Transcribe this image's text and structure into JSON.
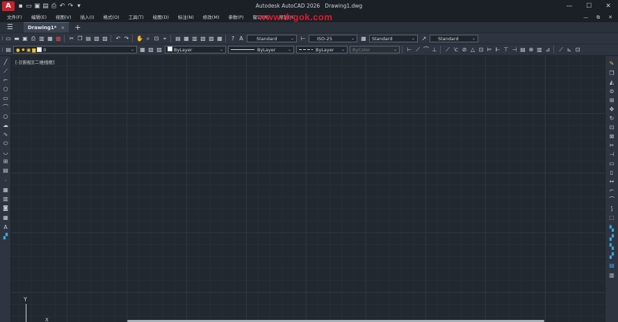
{
  "titlebar": {
    "app_name": "Autodesk AutoCAD 2026",
    "file_name": "Drawing1.dwg",
    "logo_letter": "A",
    "minimize": "—",
    "restore": "☐",
    "close": "✕"
  },
  "menubar": {
    "items": [
      "文件(F)",
      "编辑(E)",
      "视图(V)",
      "插入(I)",
      "格式(O)",
      "工具(T)",
      "绘图(D)",
      "标注(N)",
      "修改(M)",
      "参数(P)",
      "窗口(W)",
      "帮助(H)"
    ],
    "right_minimize": "—",
    "right_restore": "⧉",
    "right_close": "✕"
  },
  "watermark": "www.drgok.com",
  "tabbar": {
    "menu_icon": "☰",
    "tab_label": "Drawing1*",
    "tab_close": "×",
    "new_tab": "+"
  },
  "toolbar1": {
    "text_style": "Standard",
    "dim_style": "ISO-25",
    "table_style": "Standard",
    "mleader_style": "Standard"
  },
  "toolbar2": {
    "layer": "0",
    "color": "ByLayer",
    "linetype": "ByLayer",
    "lineweight": "ByLayer",
    "plot_style": "ByColor"
  },
  "viewport": {
    "label": "[-][俯视][二维线框]",
    "ucs_y": "Y",
    "ucs_x": "X"
  }
}
